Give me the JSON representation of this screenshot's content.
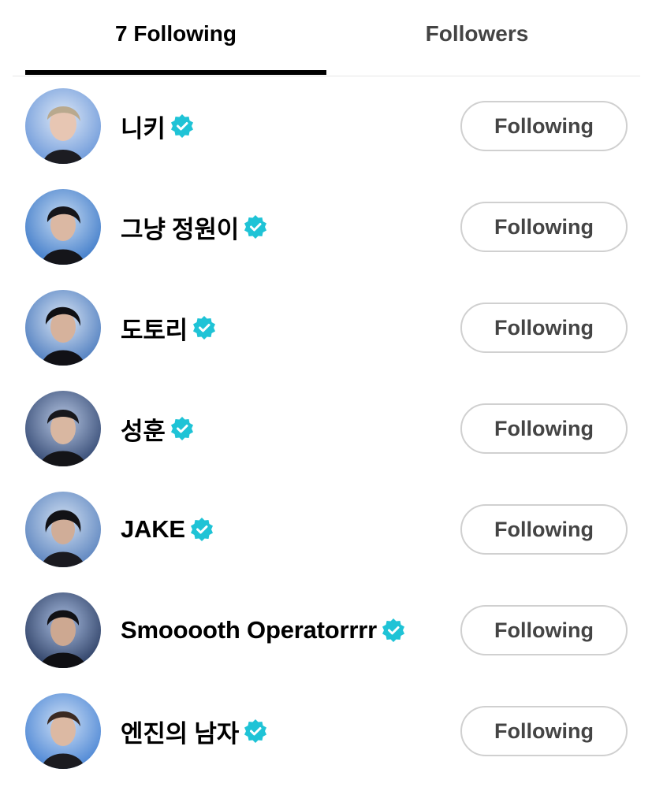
{
  "tabs": {
    "following_label": "7 Following",
    "followers_label": "Followers"
  },
  "colors": {
    "verified_badge": "#1fc3d6",
    "button_border": "#d0d0d0",
    "active_tab_underline": "#000000"
  },
  "users": [
    {
      "name": "니키",
      "verified": true,
      "button_label": "Following"
    },
    {
      "name": "그냥 정원이",
      "verified": true,
      "button_label": "Following"
    },
    {
      "name": "도토리",
      "verified": true,
      "button_label": "Following"
    },
    {
      "name": "성훈",
      "verified": true,
      "button_label": "Following"
    },
    {
      "name": "JAKE",
      "verified": true,
      "button_label": "Following"
    },
    {
      "name": "Smooooth Operatorrrr",
      "verified": true,
      "button_label": "Following"
    },
    {
      "name": "엔진의 남자",
      "verified": true,
      "button_label": "Following"
    }
  ]
}
